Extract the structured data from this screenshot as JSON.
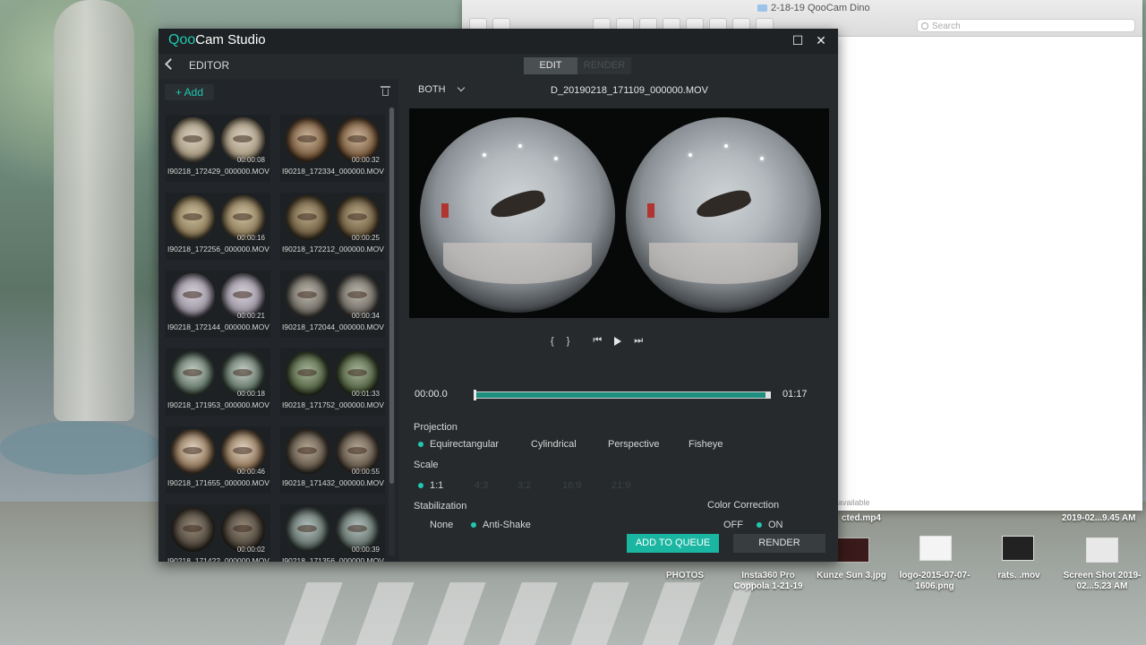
{
  "app": {
    "brand_q": "Qoo",
    "brand_cam": "Cam",
    "brand_studio": " Studio",
    "editor_title": "EDITOR",
    "mode_tabs": [
      "EDIT",
      "RENDER"
    ]
  },
  "library": {
    "add_label": "+ Add",
    "clips": [
      {
        "name": "I90218_172429_000000.MOV",
        "duration": "00:00:08"
      },
      {
        "name": "I90218_172334_000000.MOV",
        "duration": "00:00:32"
      },
      {
        "name": "I90218_172256_000000.MOV",
        "duration": "00:00:16"
      },
      {
        "name": "I90218_172212_000000.MOV",
        "duration": "00:00:25"
      },
      {
        "name": "I90218_172144_000000.MOV",
        "duration": "00:00:21"
      },
      {
        "name": "I90218_172044_000000.MOV",
        "duration": "00:00:34"
      },
      {
        "name": "I90218_171953_000000.MOV",
        "duration": "00:00:18"
      },
      {
        "name": "I90218_171752_000000.MOV",
        "duration": "00:01:33"
      },
      {
        "name": "I90218_171655_000000.MOV",
        "duration": "00:00:46"
      },
      {
        "name": "I90218_171432_000000.MOV",
        "duration": "00:00:55"
      },
      {
        "name": "I90218_171422_000000.MOV",
        "duration": "00:00:02"
      },
      {
        "name": "I90218_171356_000000.MOV",
        "duration": "00:00:39"
      }
    ]
  },
  "preview": {
    "view_mode": "BOTH",
    "file_name": "D_20190218_171109_000000.MOV",
    "time_start": "00:00.0",
    "time_end": "01:17",
    "playback_progress": 0.0
  },
  "projection": {
    "label": "Projection",
    "options": [
      "Equirectangular",
      "Cylindrical",
      "Perspective",
      "Fisheye"
    ],
    "selected": "Equirectangular"
  },
  "scale": {
    "label": "Scale",
    "options": [
      "1:1",
      "4:3",
      "3:2",
      "16:9",
      "21:9"
    ],
    "selected": "1:1"
  },
  "stabilization": {
    "label": "Stabilization",
    "options": [
      "None",
      "Anti-Shake"
    ],
    "selected": "Anti-Shake"
  },
  "color_correction": {
    "label": "Color Correction",
    "options": [
      "OFF",
      "ON"
    ],
    "selected": "ON"
  },
  "actions": {
    "queue": "ADD TO QUEUE",
    "render": "RENDER"
  },
  "finder": {
    "title": "2-18-19 QooCam Dino",
    "search_placeholder": "Search",
    "status": "available"
  },
  "desktop": {
    "items": [
      {
        "label": "PHOTOS"
      },
      {
        "label": "Insta360 Pro Coppola 1-21-19"
      },
      {
        "label": "Kunze Sun 3.jpg"
      },
      {
        "label": "logo-2015-07-07-1606.png"
      },
      {
        "label": "rats. .mov"
      },
      {
        "label": "Screen Shot 2019-02...5.23 AM"
      }
    ],
    "partial_file": "cted.mp4",
    "partial_date": "2019-02...9.45 AM"
  },
  "colors": {
    "accent": "#1fc8b2",
    "app_bg": "#262a2c",
    "queue_button": "#1ab6a2"
  }
}
